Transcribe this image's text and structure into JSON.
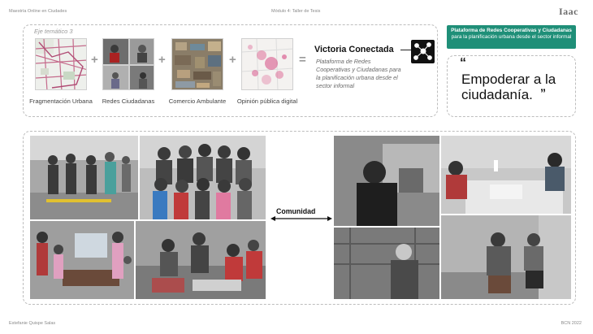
{
  "header": {
    "left": "Maestría Online en Ciudades",
    "center": "Módulo 4: Taller de Tesis",
    "logo": "Iaac"
  },
  "eje": {
    "title": "Eje temático 3",
    "items": [
      {
        "caption": "Fragmentación Urbana"
      },
      {
        "caption": "Redes Ciudadanas"
      },
      {
        "caption": "Comercio Ambulante"
      },
      {
        "caption": "Opinión pública digital"
      }
    ],
    "result_title": "Victoria Conectada",
    "result_subtitle": "Plataforma de Redes Cooperativas y Ciudadanas para la planificación urbana desde el sector informal"
  },
  "greenbox": {
    "bold": "Plataforma de Redes Cooperativas y Ciudadanas",
    "rest": " para la planificación urbana desde el sector informal"
  },
  "quote": {
    "open": "“",
    "line1": "Empoderar a la",
    "line2": "ciudadanía.",
    "close": "”"
  },
  "community_label": "Comunidad",
  "footer": {
    "left": "Estefanie Quispe Salas",
    "right": "BCN 2022"
  },
  "colors": {
    "accent": "#1f8f78",
    "dashed": "#bdbdbd"
  }
}
